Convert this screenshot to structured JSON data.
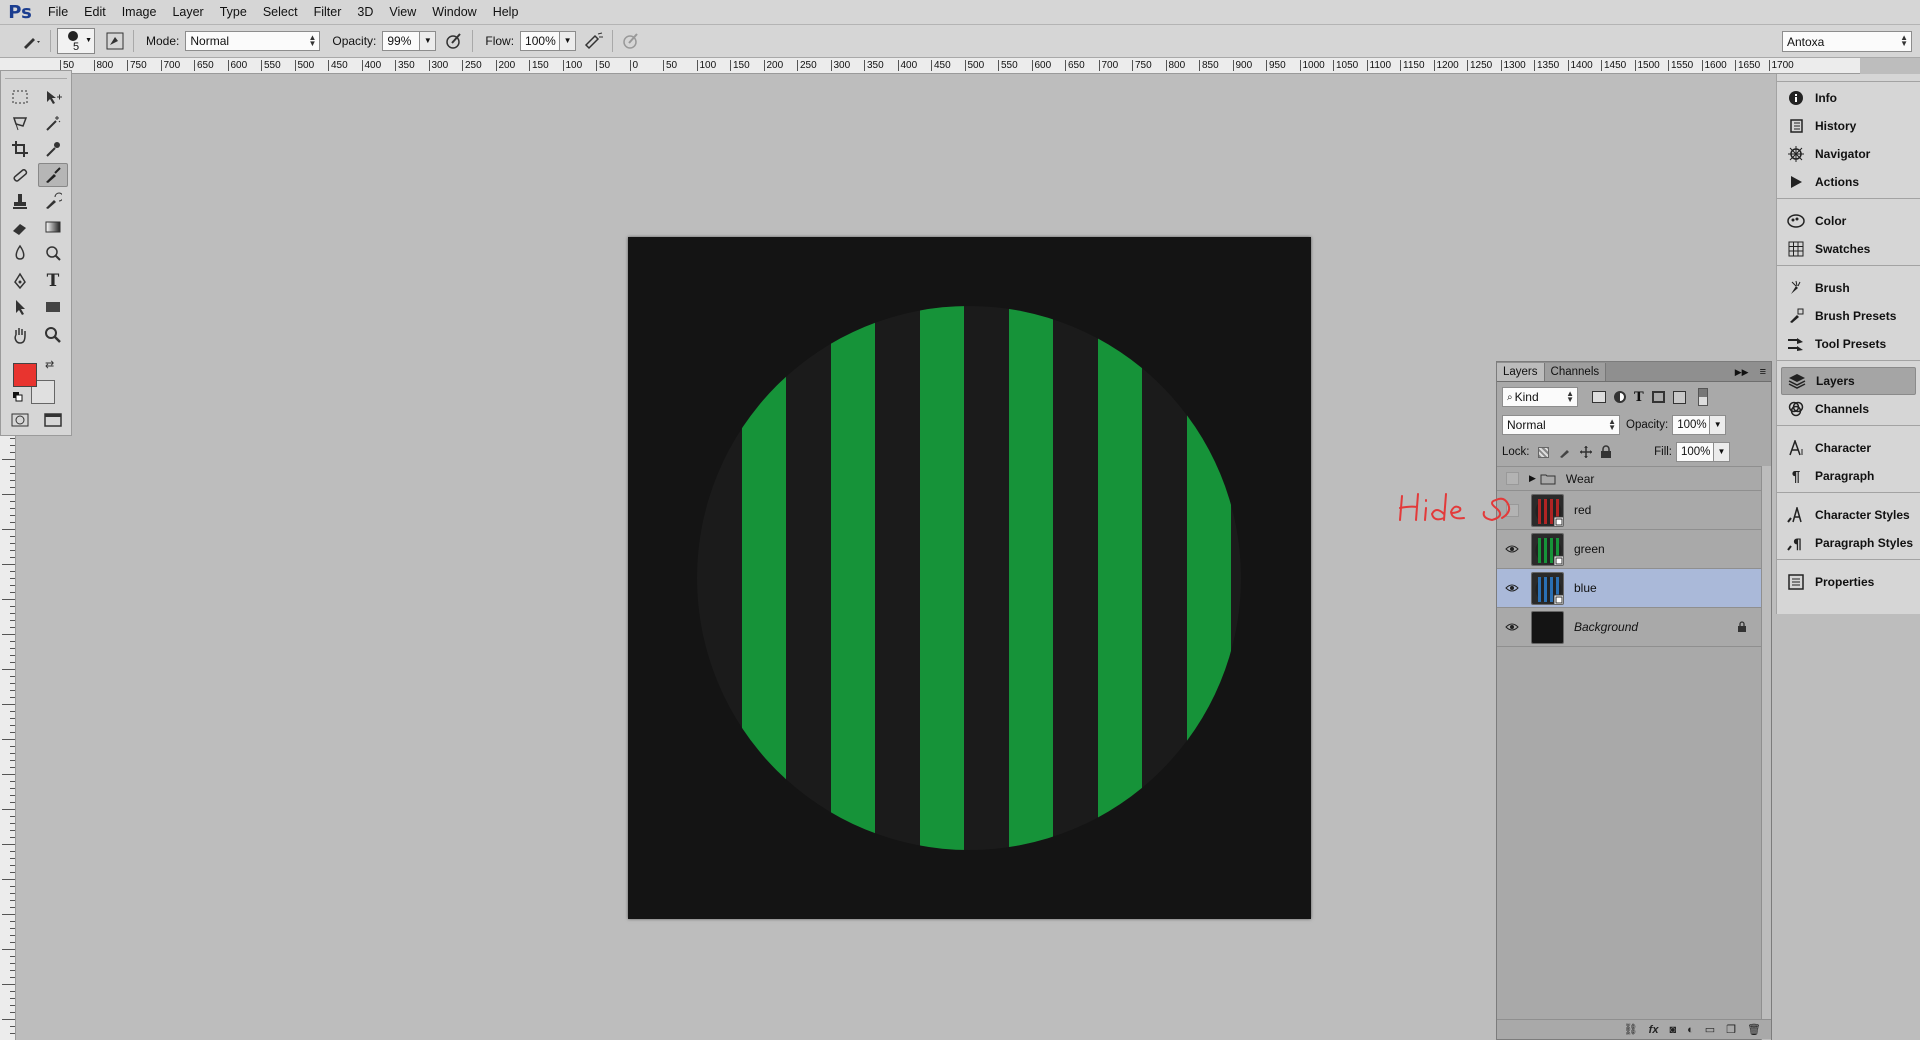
{
  "app": {
    "logo": "Ps"
  },
  "menu": [
    "File",
    "Edit",
    "Image",
    "Layer",
    "Type",
    "Select",
    "Filter",
    "3D",
    "View",
    "Window",
    "Help"
  ],
  "options": {
    "brush_size": "5",
    "mode_label": "Mode:",
    "mode_value": "Normal",
    "opacity_label": "Opacity:",
    "opacity_value": "99%",
    "flow_label": "Flow:",
    "flow_value": "100%"
  },
  "workspace": "Antoxa",
  "ruler_ticks": [
    "50",
    "800",
    "750",
    "700",
    "650",
    "600",
    "550",
    "500",
    "450",
    "400",
    "350",
    "300",
    "250",
    "200",
    "150",
    "100",
    "50",
    "0",
    "50",
    "100",
    "150",
    "200",
    "250",
    "300",
    "350",
    "400",
    "450",
    "500",
    "550",
    "600",
    "650",
    "700",
    "750",
    "800",
    "850",
    "900",
    "950",
    "1000",
    "1050",
    "1100",
    "1150",
    "1200",
    "1250",
    "1300",
    "1350",
    "1400",
    "1450",
    "1500",
    "1550",
    "1600",
    "1650",
    "1700"
  ],
  "colors": {
    "foreground": "#e8342f",
    "background": "#e0e0e0",
    "stripe": "#169339",
    "doc_bg": "#141414",
    "circle": "#1b1b1b",
    "selection": "#aab9d9",
    "annotation": "#e33a3a"
  },
  "layers_panel": {
    "tabs": [
      "Layers",
      "Channels"
    ],
    "filter": "Kind",
    "blend_mode": "Normal",
    "opacity_label": "Opacity:",
    "opacity_value": "100%",
    "lock_label": "Lock:",
    "fill_label": "Fill:",
    "fill_value": "100%",
    "layers": [
      {
        "name": "Wear",
        "type": "group",
        "visible": false
      },
      {
        "name": "red",
        "type": "smart",
        "visible": false,
        "thumb": "red"
      },
      {
        "name": "green",
        "type": "smart",
        "visible": true,
        "thumb": "green"
      },
      {
        "name": "blue",
        "type": "smart",
        "visible": true,
        "thumb": "blue",
        "selected": true
      },
      {
        "name": "Background",
        "type": "background",
        "visible": true,
        "locked": true
      }
    ]
  },
  "annotation": "Hide",
  "dock": {
    "groups": [
      [
        "Info",
        "History",
        "Navigator",
        "Actions"
      ],
      [
        "Color",
        "Swatches"
      ],
      [
        "Brush",
        "Brush Presets",
        "Tool Presets"
      ],
      [
        "Layers",
        "Channels"
      ],
      [
        "Character",
        "Paragraph"
      ],
      [
        "Character Styles",
        "Paragraph Styles"
      ],
      [
        "Properties"
      ]
    ],
    "active": "Layers"
  }
}
